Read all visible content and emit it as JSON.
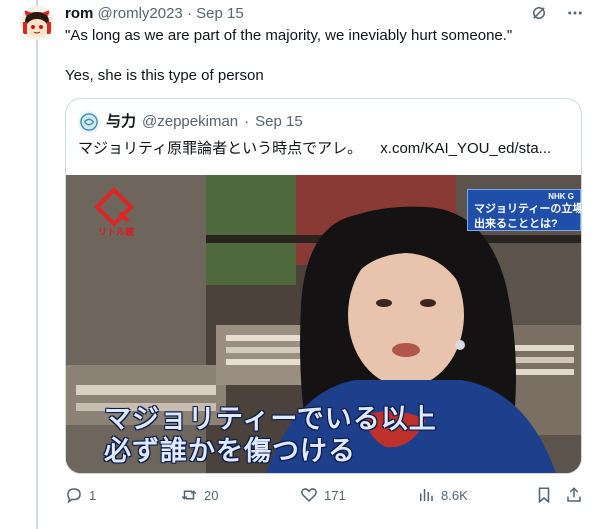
{
  "tweet": {
    "author_name": "rom",
    "handle": "@romly2023",
    "separator": "·",
    "date": "Sep 15",
    "text_line1": "\"As long as we are part of the majority, we ineviably hurt someone.\"",
    "text_line2": "Yes, she is this type of person",
    "avatar_icon": "yukkuri-avatar-icon"
  },
  "quoted_tweet": {
    "author_name": "与力",
    "handle": "@zeppekiman",
    "separator": "·",
    "date": "Sep 15",
    "text": "マジョリティ原罪論者という時点でアレ。",
    "link": "x.com/KAI_YOU_ed/sta...",
    "media": {
      "subtitle_line1": "マジョリティーでいる以上",
      "subtitle_line2": "必ず誰かを傷つける",
      "corner_box_line1": "マジョリティーの立場が",
      "corner_box_line2": "出来ることとは?",
      "corner_logo": "NHK G",
      "left_logo_text": "リトル鏡"
    }
  },
  "actions": {
    "reply_count": "1",
    "retweet_count": "20",
    "like_count": "171",
    "views_count": "8.6K"
  },
  "colors": {
    "muted": "#536471",
    "border": "#cfd9de",
    "text": "#0f1419"
  }
}
